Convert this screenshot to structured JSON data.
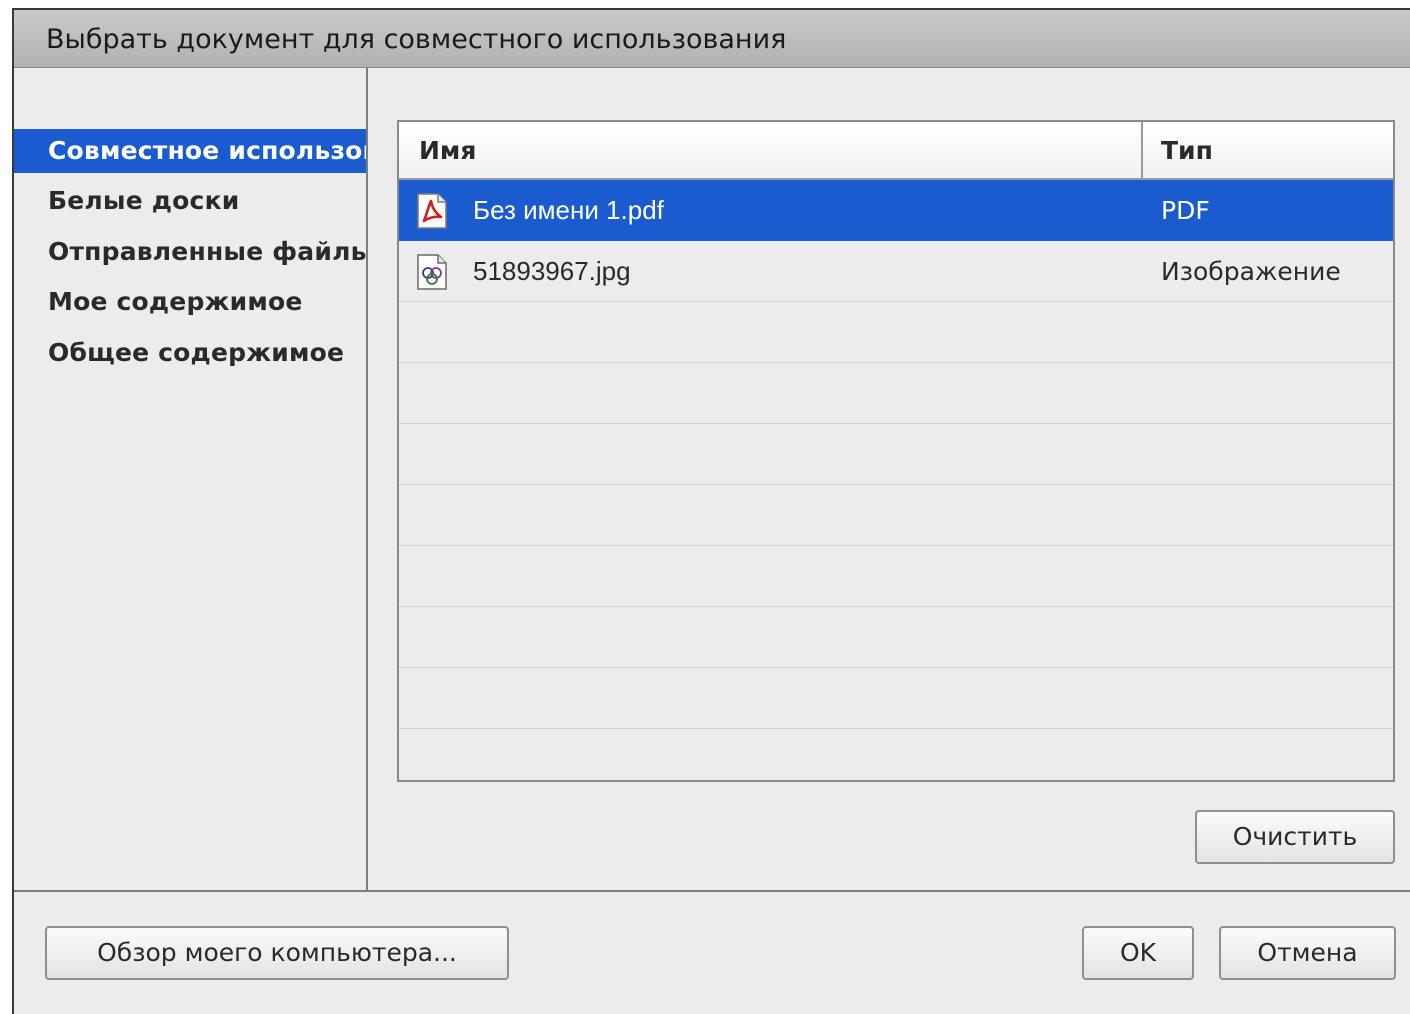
{
  "dialog": {
    "title": "Выбрать документ для совместного использования"
  },
  "sidebar": {
    "items": [
      {
        "label": "Совместное использование",
        "selected": true
      },
      {
        "label": "Белые доски",
        "selected": false
      },
      {
        "label": "Отправленные файлы",
        "selected": false
      },
      {
        "label": "Мое содержимое",
        "selected": false
      },
      {
        "label": "Общее содержимое",
        "selected": false
      }
    ]
  },
  "file_list": {
    "columns": {
      "name": "Имя",
      "type": "Тип"
    },
    "rows": [
      {
        "name": "Без имени 1.pdf",
        "type": "PDF",
        "icon": "pdf-file-icon",
        "selected": true
      },
      {
        "name": "51893967.jpg",
        "type": "Изображение",
        "icon": "image-file-icon",
        "selected": false
      }
    ]
  },
  "buttons": {
    "clear": "Очистить",
    "browse": "Обзор моего компьютера...",
    "ok": "OK",
    "cancel": "Отмена"
  },
  "colors": {
    "selection": "#1a5ccf",
    "background": "#ececec"
  }
}
